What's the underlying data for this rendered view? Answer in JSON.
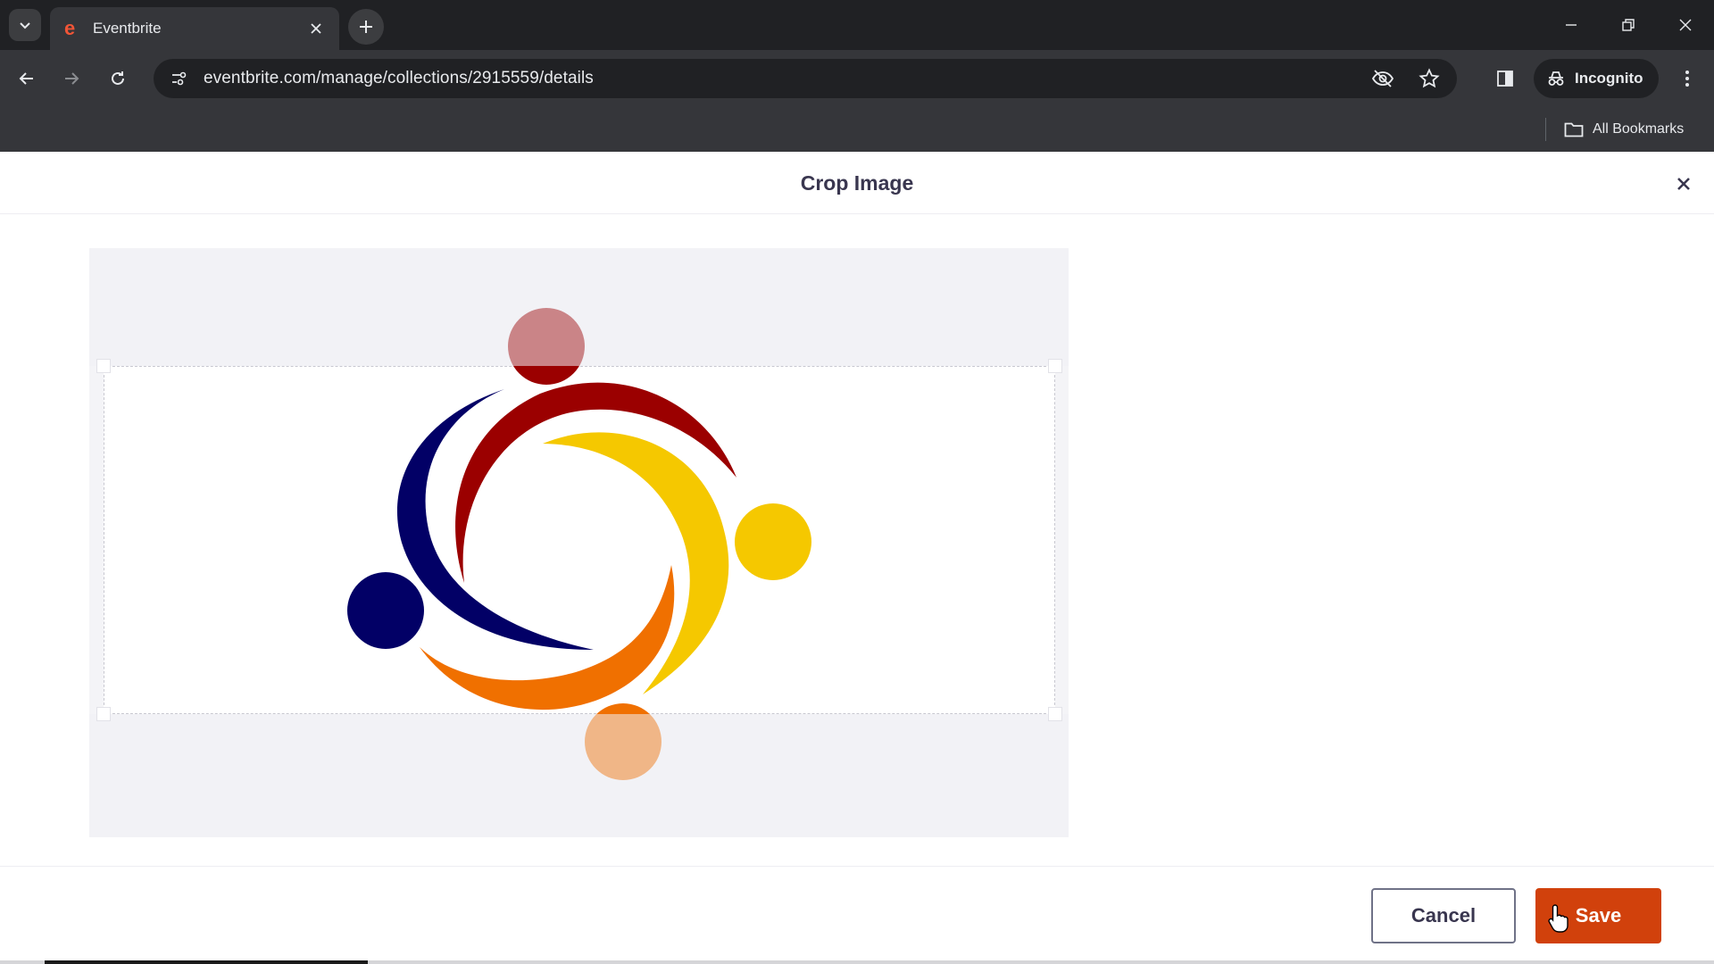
{
  "browser": {
    "tab": {
      "title": "Eventbrite",
      "favicon": "eventbrite-e-icon"
    },
    "url": "eventbrite.com/manage/collections/2915559/details",
    "incognito_label": "Incognito",
    "bookmarks_label": "All Bookmarks"
  },
  "modal": {
    "title": "Crop Image",
    "cancel_label": "Cancel",
    "save_label": "Save"
  },
  "colors": {
    "brand_orange": "#d1410c",
    "logo_navy": "#020066",
    "logo_crimson": "#9b0000",
    "logo_yellow": "#f5c800",
    "logo_orange": "#f07000"
  }
}
